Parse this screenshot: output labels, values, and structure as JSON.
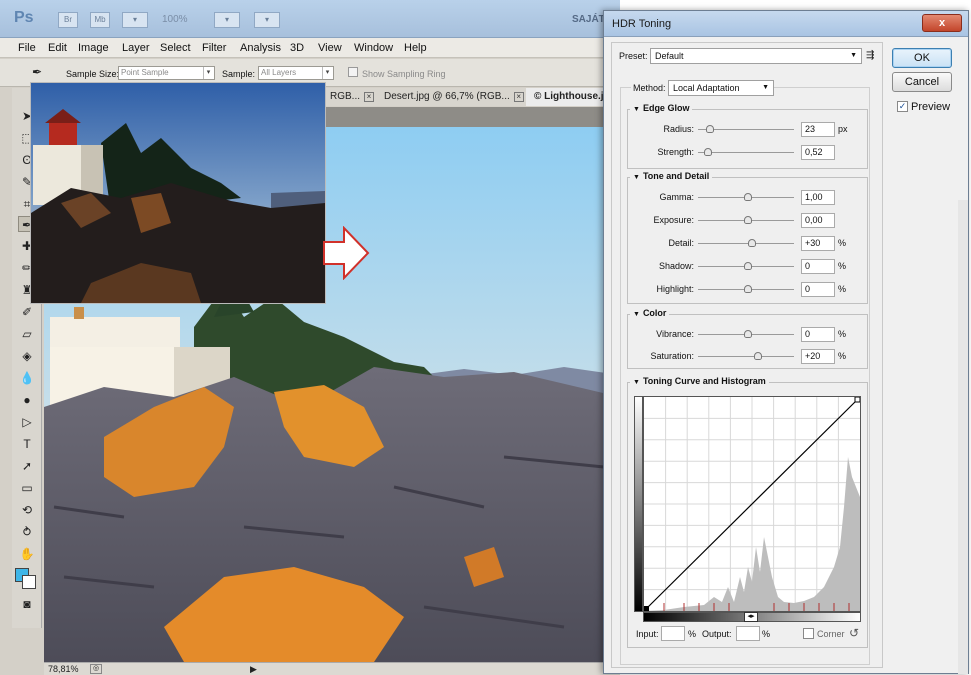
{
  "app": {
    "logo": "Ps",
    "bridge_btn": "Br",
    "minibridge_btn": "Mb",
    "zoom": "100%",
    "workspace": "SAJÁT"
  },
  "menu": [
    "File",
    "Edit",
    "Image",
    "Layer",
    "Select",
    "Filter",
    "Analysis",
    "3D",
    "View",
    "Window",
    "Help"
  ],
  "options_bar": {
    "sample_size_label": "Sample Size:",
    "sample_size_value": "Point Sample",
    "sample_label": "Sample:",
    "sample_value": "All Layers",
    "show_ring_label": "Show Sampling Ring"
  },
  "tabs": [
    {
      "label": "RGB..."
    },
    {
      "label": "Desert.jpg @ 66,7% (RGB..."
    },
    {
      "label": "© Lighthouse.jp"
    }
  ],
  "status": {
    "zoom": "78,81%"
  },
  "dialog": {
    "title": "HDR Toning",
    "close": "x",
    "preset_label": "Preset:",
    "preset_value": "Default",
    "ok": "OK",
    "cancel": "Cancel",
    "preview_label": "Preview",
    "preview_checked": true,
    "method_label": "Method:",
    "method_value": "Local Adaptation",
    "edge_glow": {
      "title": "Edge Glow",
      "radius_label": "Radius:",
      "radius_value": "23",
      "radius_unit": "px",
      "strength_label": "Strength:",
      "strength_value": "0,52"
    },
    "tone_detail": {
      "title": "Tone and Detail",
      "gamma_label": "Gamma:",
      "gamma_value": "1,00",
      "exposure_label": "Exposure:",
      "exposure_value": "0,00",
      "detail_label": "Detail:",
      "detail_value": "+30",
      "detail_unit": "%",
      "shadow_label": "Shadow:",
      "shadow_value": "0",
      "shadow_unit": "%",
      "highlight_label": "Highlight:",
      "highlight_value": "0",
      "highlight_unit": "%"
    },
    "color": {
      "title": "Color",
      "vibrance_label": "Vibrance:",
      "vibrance_value": "0",
      "vibrance_unit": "%",
      "saturation_label": "Saturation:",
      "saturation_value": "+20",
      "saturation_unit": "%"
    },
    "curve": {
      "title": "Toning Curve and Histogram",
      "input_label": "Input:",
      "input_unit": "%",
      "output_label": "Output:",
      "output_unit": "%",
      "corner_label": "Corner"
    }
  }
}
